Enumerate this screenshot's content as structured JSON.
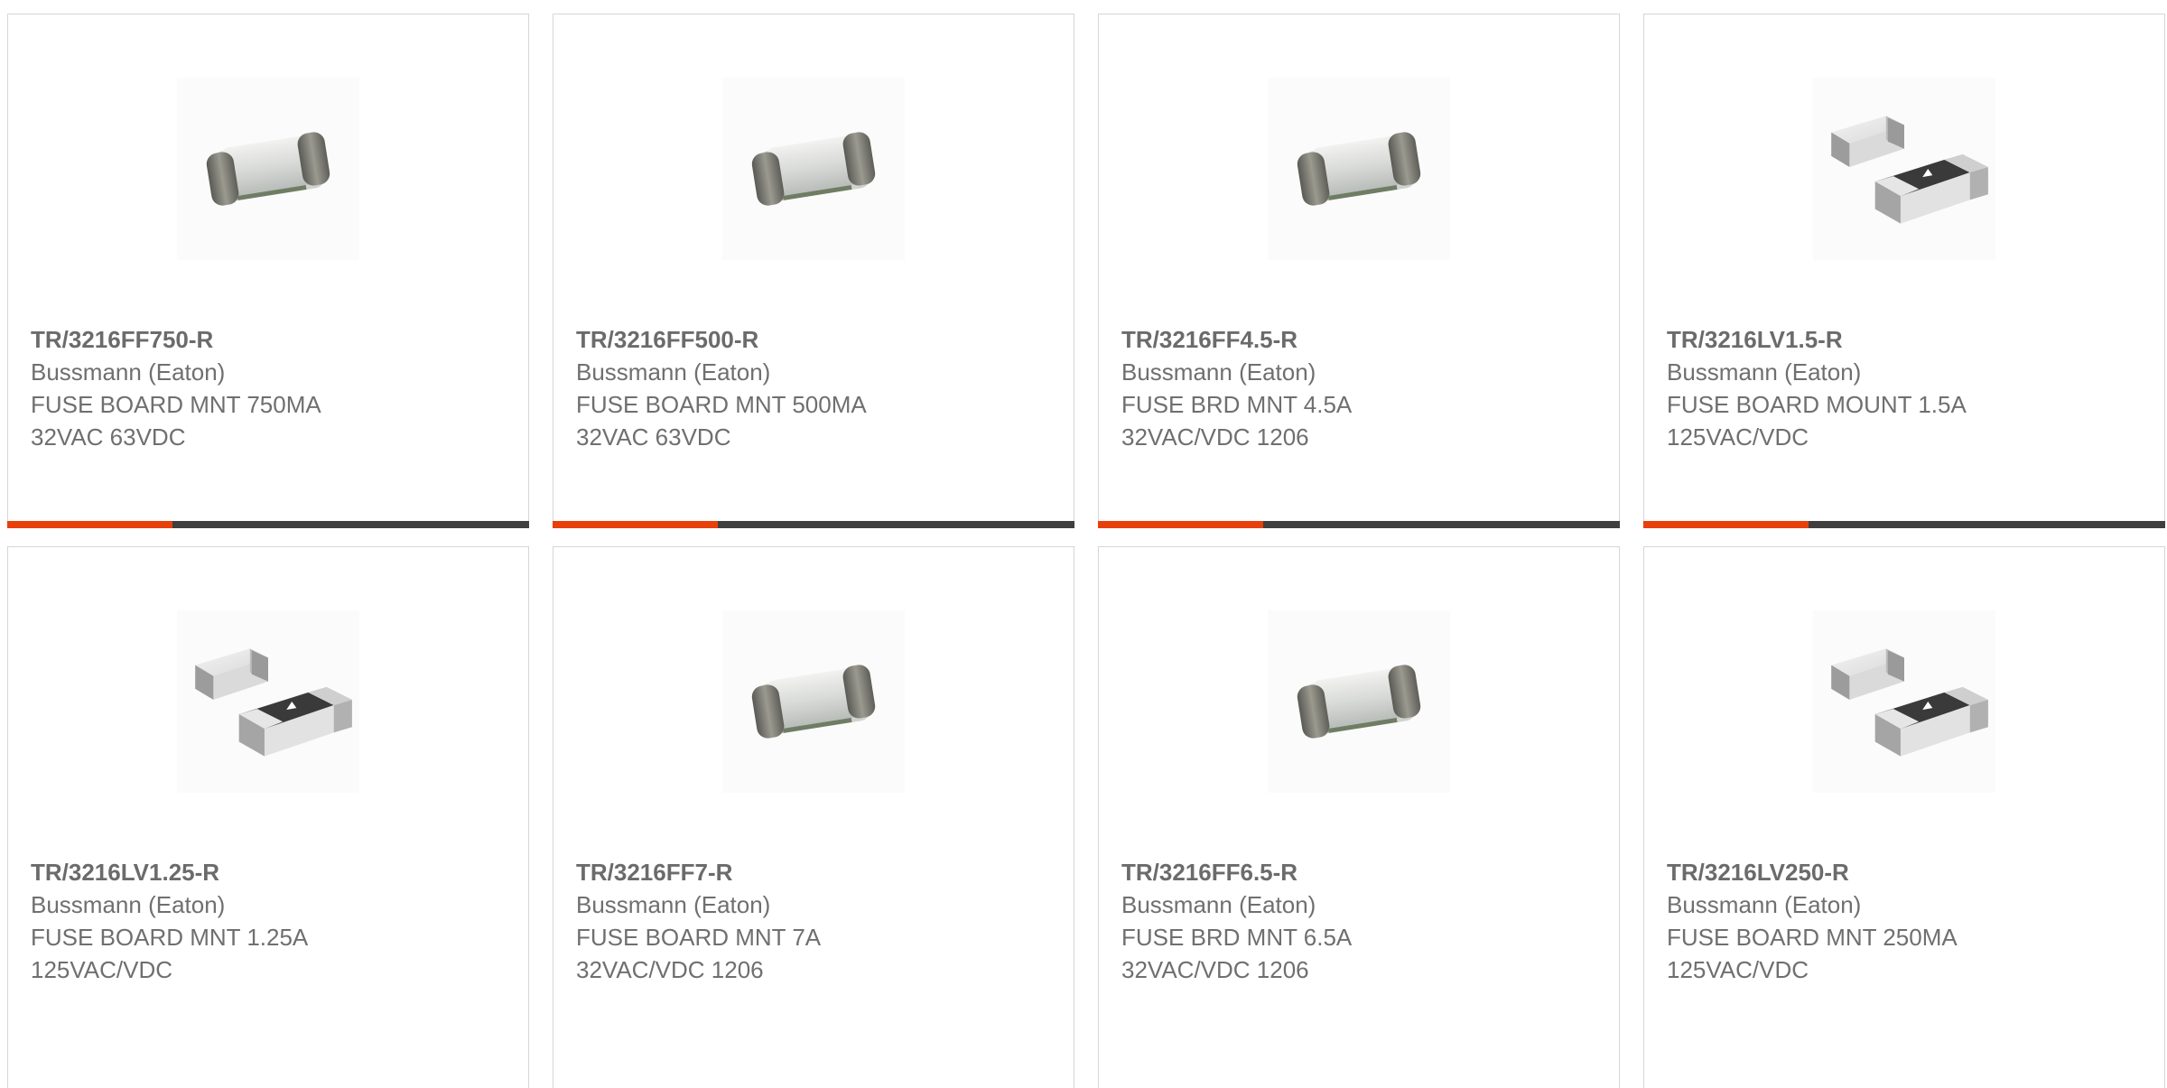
{
  "theme": {
    "accent": "#e8400c",
    "bar_dark": "#3f3f3f",
    "border": "#d6d6d6",
    "text": "#6b6b6b"
  },
  "products": [
    {
      "part_number": "TR/3216FF750-R",
      "manufacturer": "Bussmann (Eaton)",
      "desc_line1": "FUSE BOARD MNT 750MA",
      "desc_line2": "32VAC 63VDC",
      "image": "single-smd-fuse-image"
    },
    {
      "part_number": "TR/3216FF500-R",
      "manufacturer": "Bussmann (Eaton)",
      "desc_line1": "FUSE BOARD MNT 500MA",
      "desc_line2": "32VAC 63VDC",
      "image": "single-smd-fuse-image"
    },
    {
      "part_number": "TR/3216FF4.5-R",
      "manufacturer": "Bussmann (Eaton)",
      "desc_line1": "FUSE BRD MNT 4.5A",
      "desc_line2": "32VAC/VDC 1206",
      "image": "single-smd-fuse-image"
    },
    {
      "part_number": "TR/3216LV1.5-R",
      "manufacturer": "Bussmann (Eaton)",
      "desc_line1": "FUSE BOARD MOUNT 1.5A",
      "desc_line2": "125VAC/VDC",
      "image": "dual-chip-fuse-image"
    },
    {
      "part_number": "TR/3216LV1.25-R",
      "manufacturer": "Bussmann (Eaton)",
      "desc_line1": "FUSE BOARD MNT 1.25A",
      "desc_line2": "125VAC/VDC",
      "image": "dual-chip-fuse-image"
    },
    {
      "part_number": "TR/3216FF7-R",
      "manufacturer": "Bussmann (Eaton)",
      "desc_line1": "FUSE BOARD MNT 7A",
      "desc_line2": "32VAC/VDC 1206",
      "image": "single-smd-fuse-image"
    },
    {
      "part_number": "TR/3216FF6.5-R",
      "manufacturer": "Bussmann (Eaton)",
      "desc_line1": "FUSE BRD MNT 6.5A",
      "desc_line2": "32VAC/VDC 1206",
      "image": "single-smd-fuse-image"
    },
    {
      "part_number": "TR/3216LV250-R",
      "manufacturer": "Bussmann (Eaton)",
      "desc_line1": "FUSE BOARD MNT 250MA",
      "desc_line2": "125VAC/VDC",
      "image": "dual-chip-fuse-image"
    }
  ]
}
